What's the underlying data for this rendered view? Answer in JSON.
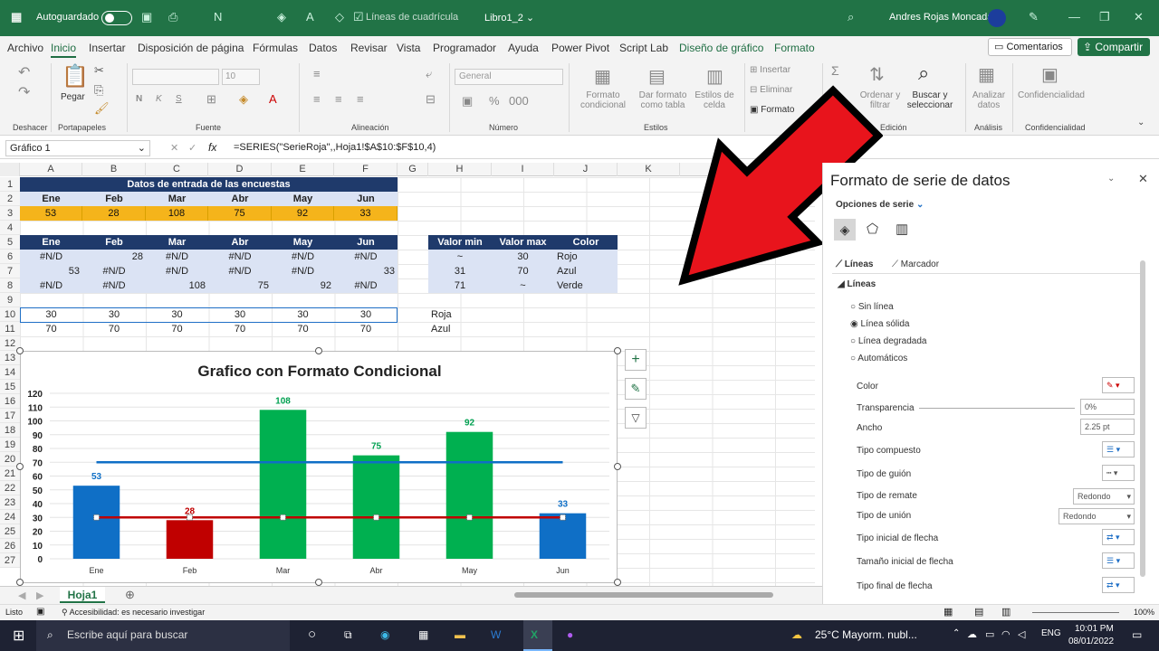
{
  "titlebar": {
    "autosave": "Autoguardado",
    "gridlines": "Líneas de cuadrícula",
    "filename": "Libro1_2 ⌄",
    "user": "Andres Rojas Moncada"
  },
  "menu": {
    "items": [
      "Archivo",
      "Inicio",
      "Insertar",
      "Disposición de página",
      "Fórmulas",
      "Datos",
      "Revisar",
      "Vista",
      "Programador",
      "Ayuda",
      "Power Pivot",
      "Script Lab",
      "Diseño de gráfico",
      "Formato"
    ],
    "comments": "Comentarios",
    "share": "Compartir"
  },
  "ribbon": {
    "undo": "Deshacer",
    "clipboard": "Portapapeles",
    "paste": "Pegar",
    "font": "Fuente",
    "font_size": "10",
    "alignment": "Alineación",
    "number": "Número",
    "number_format": "General",
    "styles": "Estilos",
    "cond_format": "Formato condicional",
    "table_format": "Dar formato como tabla",
    "cell_styles": "Estilos de celda",
    "insert": "Insertar",
    "delete": "Eliminar",
    "format": "Formato",
    "edit": "Edición",
    "sort": "Ordenar y filtrar",
    "find": "Buscar y seleccionar",
    "analysis": "Análisis",
    "analyze": "Analizar datos",
    "confidentiality": "Confidencialidad"
  },
  "formula": {
    "namebox": "Gráfico 1",
    "fx": "fx",
    "text": "=SERIES(\"SerieRoja\",,Hoja1!$A$10:$F$10,4)"
  },
  "columns": [
    "A",
    "B",
    "C",
    "D",
    "E",
    "F",
    "G",
    "H",
    "I",
    "J",
    "K"
  ],
  "rows": [
    "1",
    "2",
    "3",
    "4",
    "5",
    "6",
    "7",
    "8",
    "9",
    "10",
    "11",
    "12",
    "13",
    "14",
    "15",
    "16",
    "17",
    "18",
    "19",
    "20",
    "21",
    "22",
    "23",
    "24",
    "25",
    "26",
    "27"
  ],
  "table1": {
    "title": "Datos de entrada de las encuestas",
    "months": [
      "Ene",
      "Feb",
      "Mar",
      "Abr",
      "May",
      "Jun"
    ],
    "values": [
      "53",
      "28",
      "108",
      "75",
      "92",
      "33"
    ]
  },
  "table2": {
    "months": [
      "Ene",
      "Feb",
      "Mar",
      "Abr",
      "May",
      "Jun"
    ],
    "r6": [
      "#N/D",
      "28",
      "#N/D",
      "#N/D",
      "#N/D",
      "#N/D"
    ],
    "r7": [
      "53",
      "#N/D",
      "#N/D",
      "#N/D",
      "#N/D",
      "33"
    ],
    "r8": [
      "#N/D",
      "#N/D",
      "108",
      "75",
      "92",
      "#N/D"
    ],
    "r10": [
      "30",
      "30",
      "30",
      "30",
      "30",
      "30"
    ],
    "r11": [
      "70",
      "70",
      "70",
      "70",
      "70",
      "70"
    ]
  },
  "table3": {
    "headers": [
      "Valor min",
      "Valor max",
      "Color"
    ],
    "rows": [
      [
        "~",
        "30",
        "Rojo"
      ],
      [
        "31",
        "70",
        "Azul"
      ],
      [
        "71",
        "~",
        "Verde"
      ]
    ]
  },
  "labels": {
    "red": "Roja",
    "blue": "Azul"
  },
  "chart_data": {
    "type": "bar",
    "title": "Grafico con Formato Condicional",
    "categories": [
      "Ene",
      "Feb",
      "Mar",
      "Abr",
      "May",
      "Jun"
    ],
    "values": [
      53,
      28,
      108,
      75,
      92,
      33
    ],
    "bar_colors": [
      "#0f6fc6",
      "#c00000",
      "#00b050",
      "#00b050",
      "#00b050",
      "#0f6fc6"
    ],
    "label_colors": [
      "#0f6fc6",
      "#c00000",
      "#00a050",
      "#00a050",
      "#00a050",
      "#0f6fc6"
    ],
    "lines": [
      {
        "values": [
          30,
          30,
          30,
          30,
          30,
          30
        ],
        "color": "#c00000"
      },
      {
        "values": [
          70,
          70,
          70,
          70,
          70,
          70
        ],
        "color": "#0f6fc6"
      }
    ],
    "yticks": [
      0,
      10,
      20,
      30,
      40,
      50,
      60,
      70,
      80,
      90,
      100,
      110,
      120
    ],
    "ylim": [
      0,
      120
    ],
    "grid": true,
    "legend": "none"
  },
  "panel": {
    "title": "Formato de serie de datos",
    "options": "Opciones de serie",
    "tab_lines": "Líneas",
    "tab_marker": "Marcador",
    "section": "Líneas",
    "radios": [
      "Sin línea",
      "Línea sólida",
      "Línea degradada",
      "Automáticos"
    ],
    "color": "Color",
    "transparency": "Transparencia",
    "transparency_val": "0%",
    "width": "Ancho",
    "width_val": "2.25 pt",
    "compound": "Tipo compuesto",
    "dash": "Tipo de guión",
    "cap": "Tipo de remate",
    "cap_val": "Redondo",
    "join": "Tipo de unión",
    "join_val": "Redondo",
    "arrow_start": "Tipo inicial de flecha",
    "arrow_start_size": "Tamaño inicial de flecha",
    "arrow_end": "Tipo final de flecha"
  },
  "sheet": {
    "tab": "Hoja1"
  },
  "status": {
    "ready": "Listo",
    "accessibility": "Accesibilidad: es necesario investigar",
    "zoom": "100%"
  },
  "taskbar": {
    "search": "Escribe aquí para buscar",
    "weather": "25°C  Mayorm. nubl...",
    "lang": "ENG",
    "time": "10:01 PM",
    "date": "08/01/2022"
  },
  "colors": {
    "excel_green": "#217346",
    "navy": "#1f3a6b",
    "light_blue": "#dbe3f4",
    "orange": "#f5b41b",
    "arrow_red": "#e8141c"
  }
}
